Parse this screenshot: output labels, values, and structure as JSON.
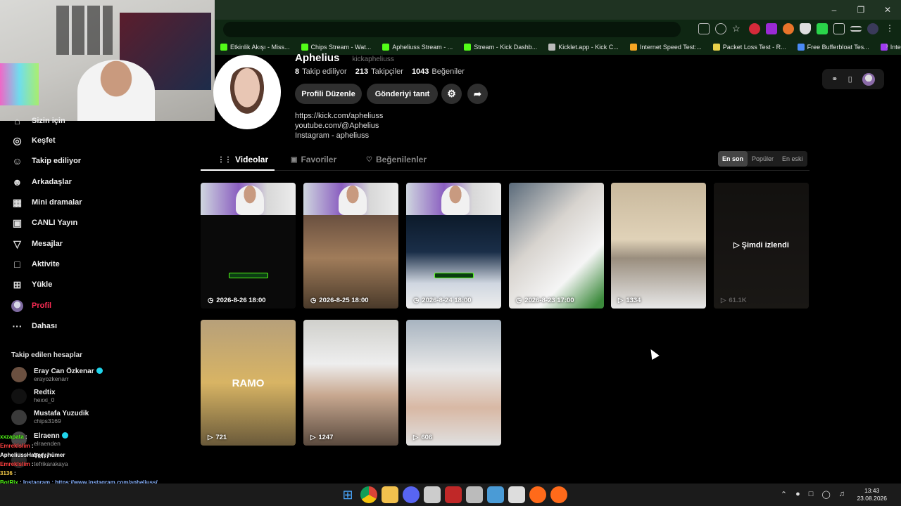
{
  "browser": {
    "bookmarks": [
      {
        "label": "Etkinlik Akışı - Miss...",
        "icon": "kick-icon",
        "color": "#53fc18"
      },
      {
        "label": "Chips Stream - Wat...",
        "icon": "kick-icon",
        "color": "#53fc18"
      },
      {
        "label": "Apheliuss Stream - ...",
        "icon": "kick-icon",
        "color": "#53fc18"
      },
      {
        "label": "Stream - Kick Dashb...",
        "icon": "kick-icon",
        "color": "#53fc18"
      },
      {
        "label": "Kicklet.app - Kick C...",
        "icon": "kicklet-icon",
        "color": "#bbbbbb"
      },
      {
        "label": "Internet Speed Test:...",
        "icon": "speedtest-icon",
        "color": "#f5a623"
      },
      {
        "label": "Packet Loss Test - R...",
        "icon": "packetloss-icon",
        "color": "#e8d04a"
      },
      {
        "label": "Free Bufferbloat Tes...",
        "icon": "bolt-icon",
        "color": "#4a8af5"
      },
      {
        "label": "Internet Hız Testi &...",
        "icon": "hiztesti-icon",
        "color": "#a03cf0"
      }
    ]
  },
  "sidebar": {
    "nav": [
      {
        "label": "Sizin için",
        "icon": "home-icon"
      },
      {
        "label": "Keşfet",
        "icon": "compass-icon"
      },
      {
        "label": "Takip ediliyor",
        "icon": "following-icon"
      },
      {
        "label": "Arkadaşlar",
        "icon": "friends-icon"
      },
      {
        "label": "Mini dramalar",
        "icon": "film-icon"
      },
      {
        "label": "CANLI Yayın",
        "icon": "live-icon"
      },
      {
        "label": "Mesajlar",
        "icon": "send-icon"
      },
      {
        "label": "Aktivite",
        "icon": "activity-icon"
      },
      {
        "label": "Yükle",
        "icon": "upload-icon"
      },
      {
        "label": "Profil",
        "icon": "profile-avatar-icon",
        "active": true
      },
      {
        "label": "Dahası",
        "icon": "more-icon"
      }
    ],
    "following_title": "Takip edilen hesaplar",
    "accounts": [
      {
        "name": "Eray Can Özkenar",
        "handle": "erayozkenarr",
        "verified": true
      },
      {
        "name": "Redtix",
        "handle": "hexxi_0",
        "verified": false
      },
      {
        "name": "Mustafa Yuzudik",
        "handle": "chips3169",
        "verified": false
      },
      {
        "name": "Elraenn",
        "handle": "elraenden",
        "verified": true
      },
      {
        "name": "Tefri",
        "handle": "tefrikarakaya",
        "verified": false
      }
    ]
  },
  "chat": [
    {
      "user": "xxzapata",
      "text": "",
      "color": "#53fc18"
    },
    {
      "user": "Emreklslim",
      "text": "",
      "color": "#ff4040"
    },
    {
      "user": "ApheliussHaber",
      "text": "hümer",
      "color": "#ffffff"
    },
    {
      "user": "Emreklslim",
      "text": "",
      "color": "#ff4040"
    },
    {
      "user": "3136",
      "text": "",
      "color": "#ffd24a"
    },
    {
      "user": "BotRix",
      "text": "Instagram : https://www.instagram.com/apheliuss/",
      "color": "#53fc18"
    },
    {
      "user": "3136",
      "text": "gerçek mi bu",
      "color": "#ffd24a"
    },
    {
      "user": "Emreklslimaman",
      "text": "",
      "color": "#ff4040"
    }
  ],
  "profile": {
    "name": "Aphelius",
    "handle": "kickapheliuss",
    "stats": {
      "following_count": "8",
      "following_label": "Takip ediliyor",
      "followers_count": "213",
      "followers_label": "Takipçiler",
      "likes_count": "1043",
      "likes_label": "Beğeniler"
    },
    "edit_button": "Profili Düzenle",
    "promote_button": "Gönderiyi tanıt",
    "bio": [
      "https://kick.com/apheliuss",
      "youtube.com/@Aphelius",
      "Instagram - apheliuss"
    ]
  },
  "tabs": [
    {
      "label": "Videolar",
      "icon": "grid-icon",
      "active": true
    },
    {
      "label": "Favoriler",
      "icon": "bookmark-icon",
      "active": false
    },
    {
      "label": "Beğenilenler",
      "icon": "heart-icon",
      "active": false
    }
  ],
  "sort": {
    "options": [
      "En son",
      "Popüler",
      "En eski"
    ],
    "selected": "En son"
  },
  "videos": [
    {
      "meta": "2026-8-26 18:00",
      "kind": "scheduled"
    },
    {
      "meta": "2026-8-25 18:00",
      "kind": "scheduled"
    },
    {
      "meta": "2026-8-24 18:00",
      "kind": "scheduled"
    },
    {
      "meta": "2026-8-23 17:00",
      "kind": "scheduled"
    },
    {
      "meta": "1334",
      "kind": "views"
    },
    {
      "meta": "61.1K",
      "kind": "views",
      "watched_label": "Şimdi izlendi"
    },
    {
      "meta": "721",
      "kind": "views",
      "thumb_text": "RAMO"
    },
    {
      "meta": "1247",
      "kind": "views"
    },
    {
      "meta": "606",
      "kind": "views"
    }
  ],
  "taskbar": {
    "time": "13:43",
    "date": "23.08.2026",
    "apps": [
      {
        "icon": "windows-start-icon",
        "color": "#4aa8ff"
      },
      {
        "icon": "chrome-icon",
        "color": "#e8b83c"
      },
      {
        "icon": "file-explorer-icon",
        "color": "#f2c14e"
      },
      {
        "icon": "discord-icon",
        "color": "#5865f2"
      },
      {
        "icon": "obs-icon",
        "color": "#cccccc"
      },
      {
        "icon": "voicemeeter-icon",
        "color": "#c02828"
      },
      {
        "icon": "horse-app-icon",
        "color": "#bbbbbb"
      },
      {
        "icon": "steam-icon",
        "color": "#4a9bd6"
      },
      {
        "icon": "epic-games-icon",
        "color": "#dddddd"
      },
      {
        "icon": "orange-app-icon",
        "color": "#ff6a1a"
      },
      {
        "icon": "orange-app-icon",
        "color": "#ff6a1a"
      }
    ]
  }
}
